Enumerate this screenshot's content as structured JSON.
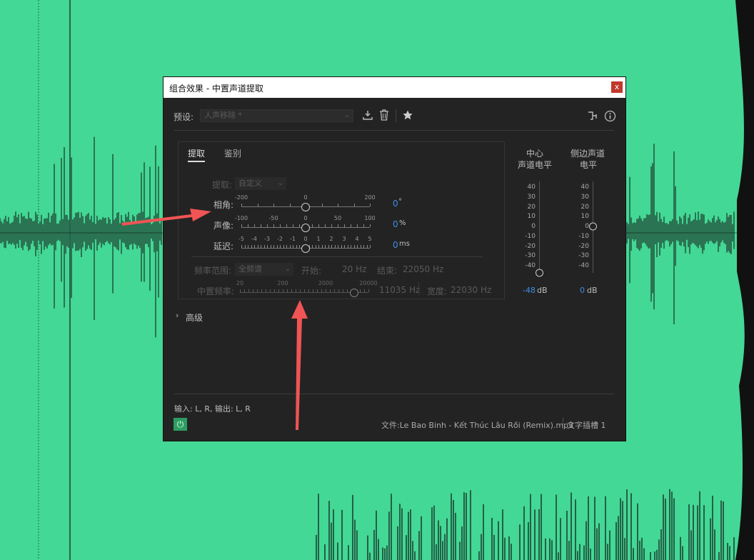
{
  "window": {
    "title": "组合效果 - 中置声道提取",
    "close_label": "x"
  },
  "toolbar": {
    "preset_label": "预设:",
    "preset_value": "人声移除 *"
  },
  "tabs": [
    {
      "label": "提取",
      "active": true
    },
    {
      "label": "鉴别",
      "active": false
    }
  ],
  "extract": {
    "label": "提取:",
    "value": "自定义"
  },
  "sliders": {
    "phase": {
      "label": "相角:",
      "ticks": [
        "-200",
        "0",
        "200"
      ],
      "value": "0",
      "unit": "°"
    },
    "pan": {
      "label": "声像:",
      "ticks": [
        "-100",
        "-50",
        "0",
        "50",
        "100"
      ],
      "value": "0",
      "unit": "%"
    },
    "delay": {
      "label": "延迟:",
      "ticks": [
        "-5",
        "-4",
        "-3",
        "-2",
        "-1",
        "0",
        "1",
        "2",
        "3",
        "4",
        "5"
      ],
      "value": "0",
      "unit": "ms"
    }
  },
  "frequency": {
    "range_label": "频率范围:",
    "range_value": "全频谱",
    "start_label": "开始:",
    "start_value": "20 Hz",
    "end_label": "结束:",
    "end_value": "22050 Hz",
    "center_label": "中置频率:",
    "center_ticks": [
      "20",
      "200",
      "2000",
      "20000"
    ],
    "center_value": "11035 Hz",
    "width_label": "宽度:",
    "width_value": "22030 Hz"
  },
  "advanced": {
    "label": "高级"
  },
  "meters": {
    "center": {
      "title_line1": "中心",
      "title_line2": "声道电平",
      "scale": [
        "40",
        "30",
        "20",
        "10",
        "0",
        "-10",
        "-20",
        "-30",
        "-40"
      ],
      "value": "-48",
      "unit": "dB",
      "level": -48
    },
    "side": {
      "title_line1": "侧边声道",
      "title_line2": "电平",
      "scale": [
        "40",
        "30",
        "20",
        "10",
        "0",
        "-10",
        "-20",
        "-30",
        "-40"
      ],
      "value": "0",
      "unit": "dB",
      "level": 0
    }
  },
  "footer": {
    "io_text": "输入: L, R,  输出: L, R",
    "file_text": "文件:Le Bao Binh - Kết Thúc Lâu Rồi (Remix).mp3",
    "slot_text": "文字插槽 1"
  },
  "icons": {
    "download": "download-icon",
    "trash": "trash-icon",
    "star": "star-icon",
    "routing": "routing-icon",
    "info": "info-icon",
    "power": "power-icon",
    "chevron": "chevron-right-icon"
  },
  "colors": {
    "background": "#43d895",
    "dialog": "#232323",
    "accent_blue": "#3d8ee6",
    "power_green": "#2e9c62",
    "arrow_red": "#f05454"
  }
}
